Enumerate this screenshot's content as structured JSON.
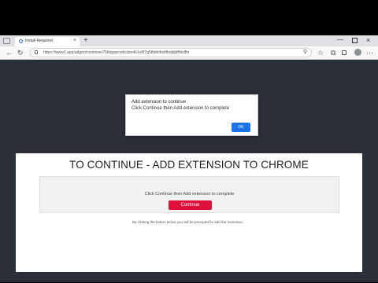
{
  "browser": {
    "tab_title": "Install Required",
    "tab_close": "×",
    "new_tab": "+",
    "url": "https://www2.app/adgeo/continue/?5kbgqxcvd/cdvs4k1v8f7g5tfabhfsdifbdjdjdfhkdfhr",
    "window_min": "—",
    "window_close": "×",
    "back_glyph": "←",
    "reload_glyph": "↻",
    "toolbar_icons": [
      "⚲",
      "☆",
      "⧉",
      "⋯"
    ],
    "icon_names": [
      "zoom-icon",
      "favorite-icon",
      "collections-icon",
      "more-icon"
    ]
  },
  "dialog": {
    "title": "Add extension to continue",
    "message": "Click Continue then Add extension to complete",
    "ok_label": "OK"
  },
  "page": {
    "headline": "TO CONTINUE - ADD EXTENSION TO CHROME",
    "instruction": "Click Continue then Add extension to complete",
    "continue_label": "Continue",
    "footnote": "By clicking the button below you will be prompted to add the               extension"
  },
  "colors": {
    "page_bg": "#2b2f38",
    "continue_button": "#e0103c",
    "ok_button": "#1a73e8"
  }
}
